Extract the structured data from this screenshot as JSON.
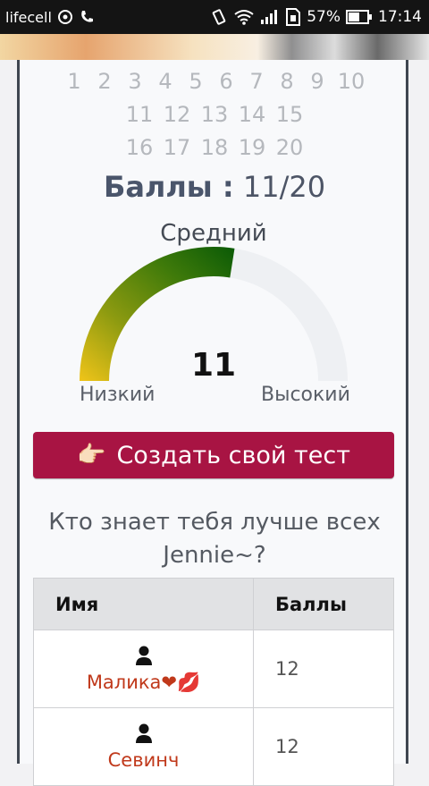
{
  "status_bar": {
    "carrier": "lifecell",
    "battery": "57%",
    "time": "17:14"
  },
  "quiz": {
    "pages_row1": [
      "1",
      "2",
      "3",
      "4",
      "5",
      "6",
      "7",
      "8",
      "9",
      "10"
    ],
    "pages_row2": [
      "11",
      "12",
      "13",
      "14",
      "15"
    ],
    "pages_row3": [
      "16",
      "17",
      "18",
      "19",
      "20"
    ],
    "score_label": "Баллы :",
    "score_value": "11/20",
    "gauge": {
      "top_label": "Средний",
      "value": "11",
      "low_label": "Низкий",
      "high_label": "Высокий",
      "fraction": 0.55
    },
    "create_button": "Создать свой тест",
    "leaderboard_title": "Кто знает тебя лучше всех Jennie~?",
    "table": {
      "col_name": "Имя",
      "col_score": "Баллы",
      "rows": [
        {
          "name": "Малика❤💋",
          "score": "12"
        },
        {
          "name": "Севинч",
          "score": "12"
        }
      ]
    }
  },
  "colors": {
    "accent": "#a81443",
    "name": "#c0391b",
    "gauge_start": "#f0c419",
    "gauge_end": "#0a5a06",
    "gauge_track": "#eef0f3"
  }
}
